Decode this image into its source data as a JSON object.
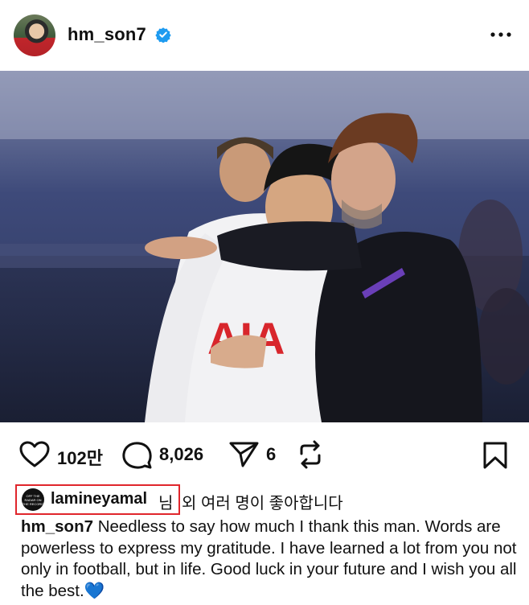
{
  "post": {
    "username": "hm_son7",
    "verified_icon": "verified-badge-icon",
    "more_icon": "more-horizontal-icon",
    "accent_color": "#1e9bf0"
  },
  "actions": {
    "like_count": "102만",
    "comment_count": "8,026",
    "share_count": "6"
  },
  "likes": {
    "liker_username": "lamineyamal",
    "liker_suffix": "님",
    "rest_text": "외 여러 명이 좋아합니다",
    "liker_avatar_text": "OFF THE RADAR ON THE RECORD",
    "highlight_color": "#e0262c"
  },
  "caption": {
    "username": "hm_son7",
    "text": "Needless to say how much I thank this man. Words are powerless to express my gratitude. I have learned a lot from you not only in football, but in life. Good luck in your future and I wish you all the best.",
    "emoji": "💙"
  },
  "photo": {
    "shirt_text": "AIA"
  }
}
